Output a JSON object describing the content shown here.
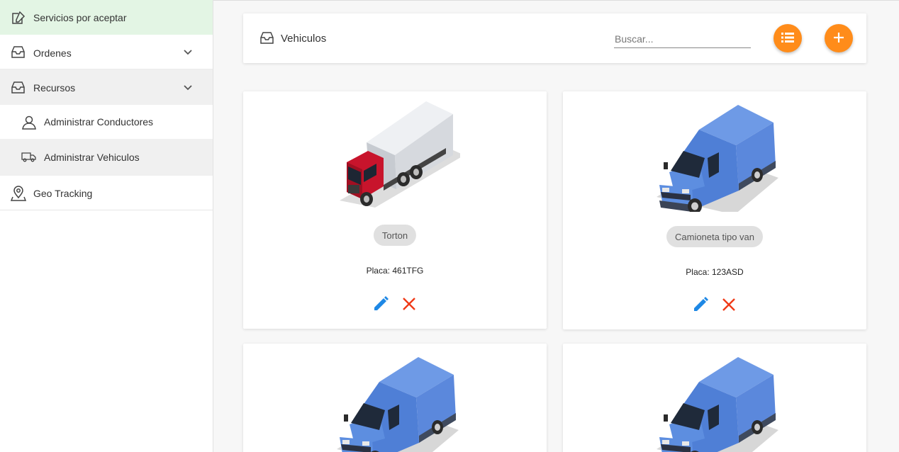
{
  "sidebar": {
    "items": [
      {
        "label": "Servicios por aceptar",
        "icon": "edit-icon"
      },
      {
        "label": "Ordenes",
        "icon": "inbox-icon"
      },
      {
        "label": "Recursos",
        "icon": "inbox-icon"
      },
      {
        "label": "Administrar Conductores",
        "icon": "user-icon"
      },
      {
        "label": "Administrar Vehiculos",
        "icon": "truck-icon"
      },
      {
        "label": "Geo Tracking",
        "icon": "map-pin-icon"
      }
    ]
  },
  "header": {
    "title": "Vehiculos",
    "search_placeholder": "Buscar...",
    "search_value": ""
  },
  "colors": {
    "accent": "#ff8c1a",
    "edit": "#1e88e5",
    "delete": "#f03a17",
    "active_bg": "#e3f5e4"
  },
  "vehicles": [
    {
      "type": "Torton",
      "placa_label": "Placa:",
      "placa": "461TFG",
      "image": "truck-image"
    },
    {
      "type": "Camioneta tipo van",
      "placa_label": "Placa:",
      "placa": "123ASD",
      "image": "van-image"
    },
    {
      "image": "van-image"
    },
    {
      "image": "van-image"
    }
  ]
}
